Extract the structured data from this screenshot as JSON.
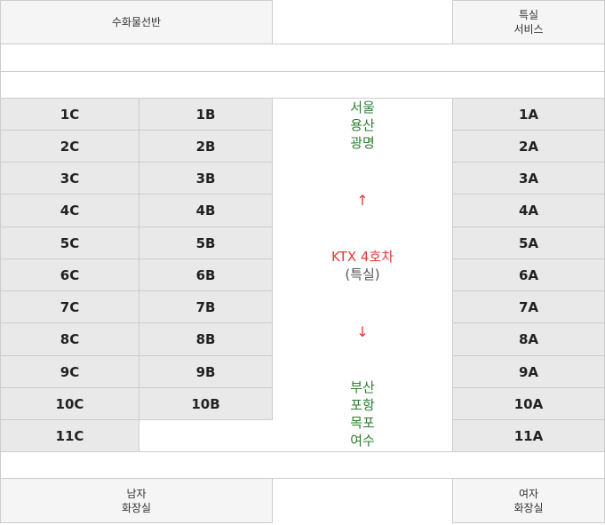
{
  "facilities": {
    "top_left": [
      "수화물선반"
    ],
    "top_right": [
      "특실",
      "서비스"
    ],
    "bottom_left": [
      "남자",
      "화장실"
    ],
    "bottom_right": [
      "여자",
      "화장실"
    ]
  },
  "seats": {
    "col_c": [
      "1C",
      "2C",
      "3C",
      "4C",
      "5C",
      "6C",
      "7C",
      "8C",
      "9C",
      "10C",
      "11C"
    ],
    "col_b": [
      "1B",
      "2B",
      "3B",
      "4B",
      "5B",
      "6B",
      "7B",
      "8B",
      "9B",
      "10B"
    ],
    "col_a": [
      "1A",
      "2A",
      "3A",
      "4A",
      "5A",
      "6A",
      "7A",
      "8A",
      "9A",
      "10A",
      "11A"
    ]
  },
  "center": {
    "north_stations": [
      "서울",
      "용산",
      "광명"
    ],
    "up_arrow": "↑",
    "car_title": "KTX 4호차",
    "car_class": "(특실)",
    "down_arrow": "↓",
    "south_stations": [
      "부산",
      "포항",
      "목포",
      "여수"
    ]
  },
  "colors": {
    "seat_bg": "#e9e9e9",
    "station_text": "#2e7d32",
    "car_title_text": "#e53935"
  }
}
